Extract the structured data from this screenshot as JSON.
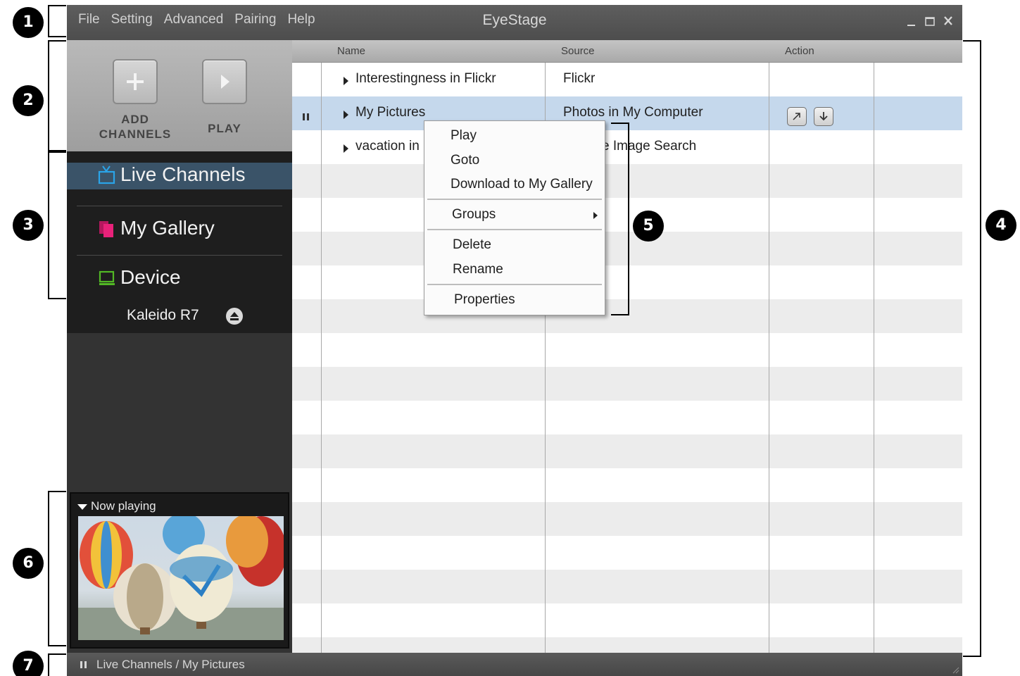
{
  "window": {
    "title": "EyeStage",
    "menu": [
      "File",
      "Setting",
      "Advanced",
      "Pairing",
      "Help"
    ],
    "controls": [
      "minimize",
      "maximize",
      "close"
    ]
  },
  "toolbar": {
    "add_channels_line1": "ADD",
    "add_channels_line2": "CHANNELS",
    "play_label": "PLAY"
  },
  "sidebar": {
    "items": [
      {
        "label": "Live Channels",
        "icon": "tv-icon",
        "color": "#2aa4e8",
        "expanded": false,
        "active": true
      },
      {
        "label": "My Gallery",
        "icon": "gallery-icon",
        "color": "#e8227a",
        "expanded": false,
        "active": false
      },
      {
        "label": "Device",
        "icon": "monitor-icon",
        "color": "#52b825",
        "expanded": true,
        "active": false
      }
    ],
    "device_child": "Kaleido R7"
  },
  "now_playing": {
    "header": "Now playing"
  },
  "grid": {
    "columns": [
      "Name",
      "Source",
      "Action"
    ],
    "rows": [
      {
        "name": "Interestingness in Flickr",
        "source": "Flickr",
        "selected": false
      },
      {
        "name": "My Pictures",
        "source": "Photos in My Computer",
        "selected": true,
        "playing": true
      },
      {
        "name": "vacation in",
        "source": "e Image Search",
        "selected": false
      }
    ]
  },
  "context_menu": {
    "items": [
      "Play",
      "Goto",
      "Download to My Gallery",
      "Groups",
      "Delete",
      "Rename",
      "Properties"
    ]
  },
  "status": {
    "path": "Live Channels / My Pictures"
  },
  "callouts": [
    "1",
    "2",
    "3",
    "4",
    "5",
    "6",
    "7"
  ]
}
